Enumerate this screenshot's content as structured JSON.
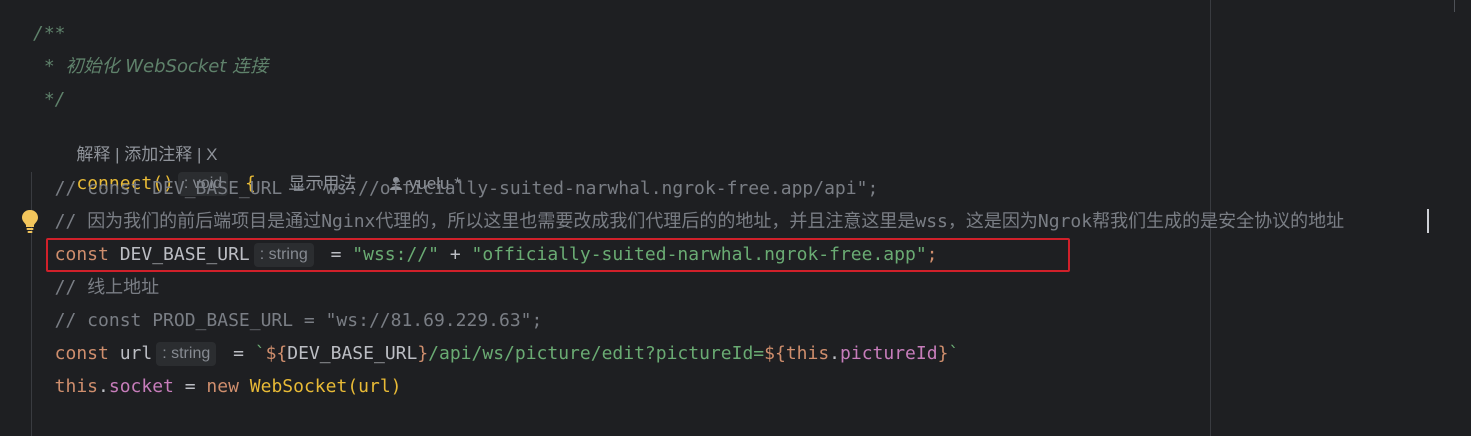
{
  "editor": {
    "colors": {
      "background": "#1e1f22",
      "keyword": "#cf8e6d",
      "string": "#6aab73",
      "comment": "#7a7e85",
      "doc_comment": "#5f826b",
      "function": "#56a8f5",
      "property": "#c77dbb",
      "highlight_box": "#d0202a"
    },
    "doc": {
      "open": "/**",
      "middle_prefix": " * ",
      "middle_text": "初始化 WebSocket 连接",
      "close": " */"
    },
    "codelens": {
      "explain": "解释",
      "sep1": " | ",
      "add_comment": "添加注释",
      "sep2": " | ",
      "close": "X"
    },
    "signature": {
      "name": "connect",
      "parens": "()",
      "return_hint": ": void",
      "brace": "{",
      "show_usages": "显示用法",
      "author_icon": "person-icon",
      "author": "yuelu *"
    },
    "lines": {
      "l1": "  // const DEV_BASE_URL = \"ws://officially-suited-narwhal.ngrok-free.app/api\";",
      "l2_prefix": "  // ",
      "l2_a": "因为我们的前后端项目是通过",
      "l2_b": "Nginx",
      "l2_c": "代理的，所以这里也需要改成我们代理后的的地址，并且注意这里是",
      "l2_d": "wss",
      "l2_e": "，这是因为",
      "l2_f": "Ngrok",
      "l2_g": "帮我们生成的是安全协议的地址",
      "l3_kw": "  const",
      "l3_name": " DEV_BASE_URL",
      "l3_hint": ": string",
      "l3_eq": " = ",
      "l3_s1": "\"wss://\"",
      "l3_plus": " + ",
      "l3_s2": "\"officially-suited-narwhal.ngrok-free.app\"",
      "l3_semi": ";",
      "l4_prefix": "  // ",
      "l4_text": "线上地址",
      "l5": "  // const PROD_BASE_URL = \"ws://81.69.229.63\";",
      "l6_kw": "  const",
      "l6_name": " url",
      "l6_hint": ": string",
      "l6_eq": " = ",
      "l6_tick": "`",
      "l6_open1": "${",
      "l6_var": "DEV_BASE_URL",
      "l6_close1": "}",
      "l6_path": "/api/ws/picture/edit?pictureId=",
      "l6_open2": "${",
      "l6_this": "this",
      "l6_dot": ".",
      "l6_prop": "pictureId",
      "l6_close2": "}",
      "l6_tick2": "`",
      "l7_this": "  this",
      "l7_dot": ".",
      "l7_prop": "socket",
      "l7_eq": " = ",
      "l7_new": "new",
      "l7_sp": " ",
      "l7_cls": "WebSocket",
      "l7_args": "(url)"
    },
    "bulb_icon": "lightbulb-icon"
  }
}
